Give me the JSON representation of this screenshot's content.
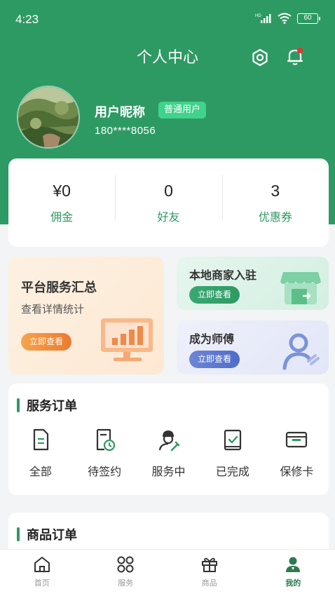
{
  "status_bar": {
    "time": "4:23",
    "battery": "60",
    "network": "HD"
  },
  "header": {
    "title": "个人中心"
  },
  "user": {
    "name": "用户昵称",
    "badge": "普通用户",
    "phone": "180****8056"
  },
  "stats": [
    {
      "value": "¥0",
      "label": "佣金"
    },
    {
      "value": "0",
      "label": "好友"
    },
    {
      "value": "3",
      "label": "优惠券"
    }
  ],
  "promos": {
    "platform": {
      "title": "平台服务汇总",
      "subtitle": "查看详情统计",
      "button": "立即查看"
    },
    "merchant": {
      "title": "本地商家入驻",
      "button": "立即查看"
    },
    "master": {
      "title": "成为师傅",
      "button": "立即查看"
    }
  },
  "service_orders": {
    "title": "服务订单",
    "items": [
      {
        "label": "全部",
        "icon": "document-icon"
      },
      {
        "label": "待签约",
        "icon": "pending-contract-icon"
      },
      {
        "label": "服务中",
        "icon": "worker-icon"
      },
      {
        "label": "已完成",
        "icon": "completed-icon"
      },
      {
        "label": "保修卡",
        "icon": "warranty-card-icon"
      }
    ]
  },
  "goods_orders": {
    "title": "商品订单"
  },
  "tabbar": [
    {
      "label": "首页",
      "icon": "home-icon",
      "active": false
    },
    {
      "label": "服务",
      "icon": "service-grid-icon",
      "active": false
    },
    {
      "label": "商品",
      "icon": "gift-icon",
      "active": false
    },
    {
      "label": "我的",
      "icon": "user-icon",
      "active": true
    }
  ],
  "colors": {
    "primary": "#2e9a63",
    "badge": "#3fd38b",
    "notification_dot": "#e8342a",
    "background": "#f3f4f6"
  }
}
